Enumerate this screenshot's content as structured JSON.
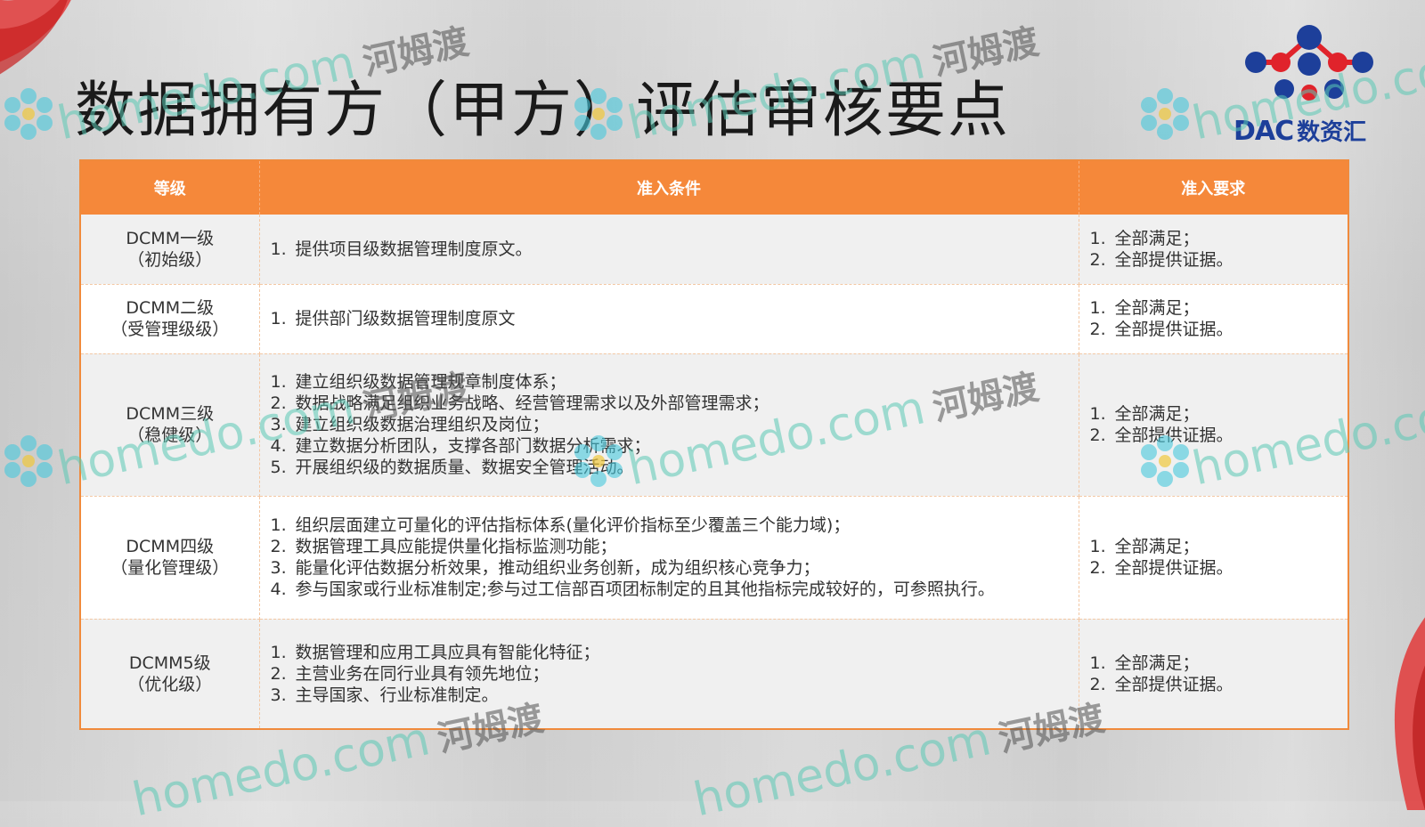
{
  "title": "数据拥有方（甲方）评估审核要点",
  "logo": {
    "brand": "DAC",
    "brand_cn": "数资汇"
  },
  "table": {
    "headers": [
      "等级",
      "准入条件",
      "准入要求"
    ],
    "rows": [
      {
        "level": "DCMM一级",
        "level_sub": "（初始级）",
        "conditions": [
          "提供项目级数据管理制度原文。"
        ],
        "requirements": [
          "全部满足；",
          "全部提供证据。"
        ]
      },
      {
        "level": "DCMM二级",
        "level_sub": "（受管理级级）",
        "conditions": [
          "提供部门级数据管理制度原文"
        ],
        "requirements": [
          "全部满足；",
          "全部提供证据。"
        ]
      },
      {
        "level": "DCMM三级",
        "level_sub": "（稳健级）",
        "conditions": [
          "建立组织级数据管理规章制度体系；",
          "数据战略满足组织业务战略、经营管理需求以及外部管理需求；",
          "建立组织级数据治理组织及岗位；",
          "建立数据分析团队，支撑各部门数据分析需求；",
          "开展组织级的数据质量、数据安全管理活动。"
        ],
        "requirements": [
          "全部满足；",
          "全部提供证据。"
        ]
      },
      {
        "level": "DCMM四级",
        "level_sub": "（量化管理级）",
        "conditions": [
          "组织层面建立可量化的评估指标体系(量化评价指标至少覆盖三个能力域)；",
          "数据管理工具应能提供量化指标监测功能；",
          "能量化评估数据分析效果，推动组织业务创新，成为组织核心竞争力；",
          "参与国家或行业标准制定;参与过工信部百项团标制定的且其他指标完成较好的，可参照执行。"
        ],
        "requirements": [
          "全部满足；",
          "全部提供证据。"
        ]
      },
      {
        "level": "DCMM5级",
        "level_sub": "（优化级）",
        "conditions": [
          "数据管理和应用工具应具有智能化特征；",
          "主营业务在同行业具有领先地位；",
          "主导国家、行业标准制定。"
        ],
        "requirements": [
          "全部满足；",
          "全部提供证据。"
        ]
      }
    ]
  },
  "watermark": {
    "text": "homedo.com",
    "text_cn": "河姆渡"
  },
  "colors": {
    "header": "#f5883a",
    "border": "#f08a3c",
    "logo_blue": "#1d3f9a",
    "logo_red": "#e0232b"
  }
}
